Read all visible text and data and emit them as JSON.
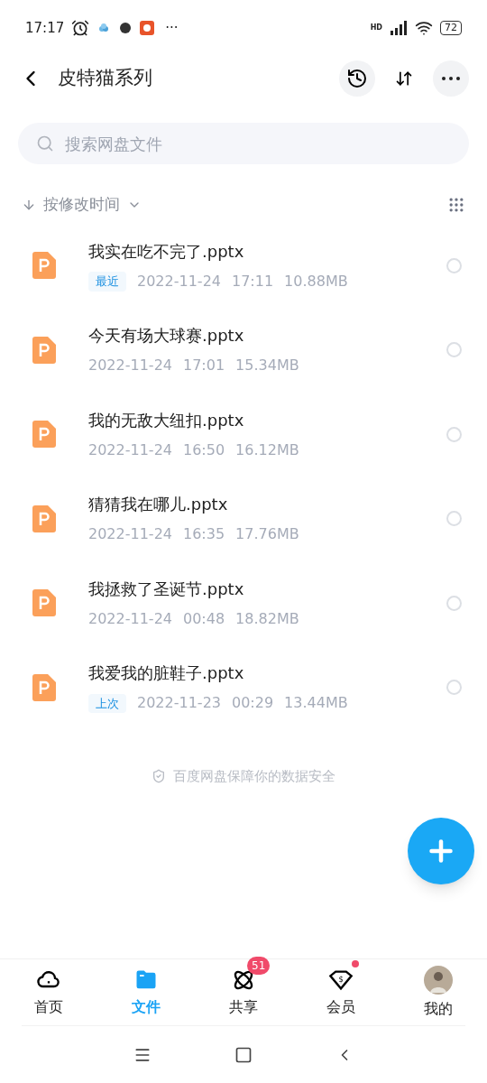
{
  "status_bar": {
    "time": "17:17",
    "more": "···",
    "battery": "72",
    "network": "HD"
  },
  "header": {
    "title": "皮特猫系列"
  },
  "search": {
    "placeholder": "搜索网盘文件"
  },
  "sort": {
    "label": "按修改时间"
  },
  "files": [
    {
      "name": "我实在吃不完了.pptx",
      "tag": "最近",
      "date": "2022-11-24",
      "time": "17:11",
      "size": "10.88MB",
      "selected": false
    },
    {
      "name": "今天有场大球赛.pptx",
      "date": "2022-11-24",
      "time": "17:01",
      "size": "15.34MB",
      "selected": false
    },
    {
      "name": "我的无敌大纽扣.pptx",
      "date": "2022-11-24",
      "time": "16:50",
      "size": "16.12MB",
      "selected": false
    },
    {
      "name": "猜猜我在哪儿.pptx",
      "date": "2022-11-24",
      "time": "16:35",
      "size": "17.76MB",
      "selected": false
    },
    {
      "name": "我拯救了圣诞节.pptx",
      "date": "2022-11-24",
      "time": "00:48",
      "size": "18.82MB",
      "selected": false
    },
    {
      "name": "我爱我的脏鞋子.pptx",
      "tag": "上次",
      "date": "2022-11-23",
      "time": "00:29",
      "size": "13.44MB",
      "selected": false
    }
  ],
  "footer_note": "百度网盘保障你的数据安全",
  "nav": [
    {
      "kind": "home",
      "label": "首页",
      "selected": false
    },
    {
      "kind": "files",
      "label": "文件",
      "selected": true
    },
    {
      "kind": "share",
      "label": "共享",
      "selected": false,
      "badge": "51"
    },
    {
      "kind": "vip",
      "label": "会员",
      "selected": false,
      "dot": true,
      "symbol": "$"
    },
    {
      "kind": "me",
      "label": "我的",
      "selected": false
    }
  ]
}
